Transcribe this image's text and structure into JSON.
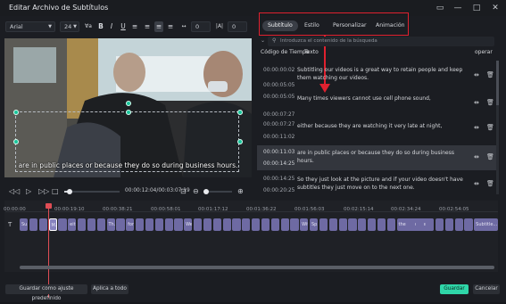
{
  "window": {
    "title": "Editar Archivo de Subtítulos",
    "controls": [
      "□",
      "—",
      "□",
      "✕"
    ]
  },
  "toolbar": {
    "font": "Arial",
    "size": "24",
    "spacing": "0",
    "line_spacing": "0"
  },
  "tabs": [
    {
      "label": "Subtítulo"
    },
    {
      "label": "Estilo"
    },
    {
      "label": "Personalizar"
    },
    {
      "label": "Animación"
    }
  ],
  "search": {
    "placeholder": "Introduzca el contenido de la búsqueda"
  },
  "list": {
    "header_timecode": "Código de Tiempo",
    "header_text": "Texto",
    "header_ops": "operar",
    "rows": [
      {
        "start": "00:00:00:02",
        "end": "00:00:05:05",
        "text": "Subtitling our videos is a great way to retain people and keep them watching our videos."
      },
      {
        "start": "00:00:05:05",
        "end": "00:00:07:27",
        "text": "Many times viewers cannot use cell phone sound,"
      },
      {
        "start": "00:00:07:27",
        "end": "00:00:11:02",
        "text": "either because they are watching it very late at night,"
      },
      {
        "start": "00:00:11:03",
        "end": "00:00:14:25",
        "text": "are in public places or because they do so during business hours."
      },
      {
        "start": "00:00:14:25",
        "end": "00:00:20:25",
        "text": "So they just look at the picture and if your video doesn't have subtitles they just move on to the next one."
      }
    ]
  },
  "video": {
    "subtitle": "are in public places or because they do so during business hours."
  },
  "player": {
    "time": "00:00:12:04/00:03:07:19"
  },
  "timeline": {
    "ruler": [
      "00:00:00",
      "00:00:19:10",
      "00:00:38:21",
      "00:00:58:01",
      "00:01:17:12",
      "00:01:36:22",
      "00:01:56:03",
      "00:02:15:14",
      "00:02:34:24",
      "00:02:54:05"
    ],
    "clips": [
      "Su...",
      "",
      "",
      "M...",
      "",
      "eit...",
      "",
      "",
      "",
      "Th...",
      "",
      "for...",
      "",
      "",
      "",
      "",
      "",
      "We a...",
      "",
      "",
      "",
      "",
      "",
      "",
      "",
      "",
      "",
      "",
      "",
      "Wit...",
      "Sp...",
      "",
      "",
      "",
      "",
      "",
      "",
      "",
      "",
      "the most conve...",
      "",
      "",
      "",
      "",
      "",
      "",
      "",
      "Subtitle..."
    ]
  },
  "buttons": {
    "save_default": "Guardar como ajuste predefinido",
    "apply_all": "Aplica a todo",
    "save": "Guardar",
    "cancel": "Cancelar"
  }
}
